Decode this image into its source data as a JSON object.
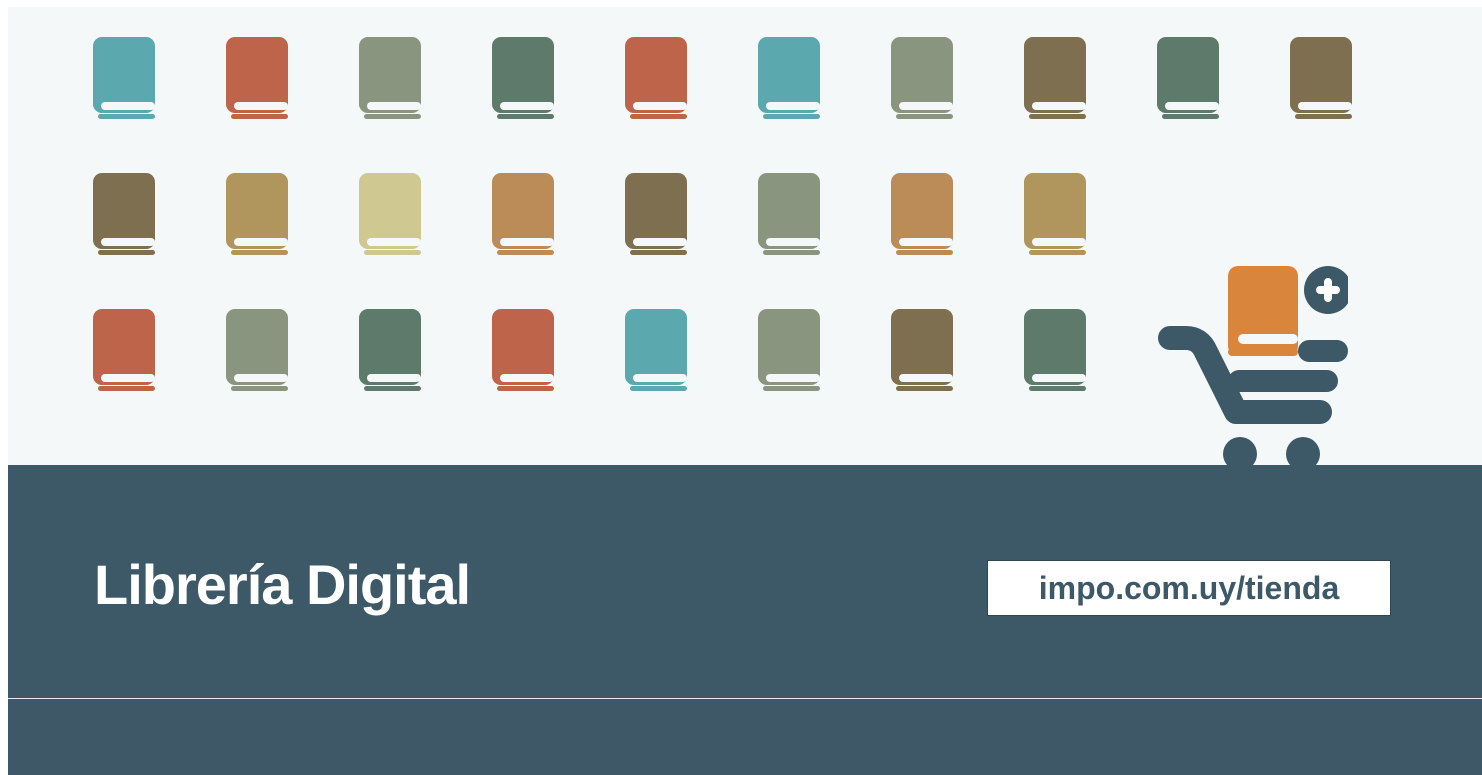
{
  "banner": {
    "title": "Librería Digital",
    "url": "impo.com.uy/tienda"
  },
  "books": {
    "rows": [
      [
        "#5ba8ae",
        "#bd644b",
        "#89957f",
        "#5e7a6b",
        "#bd644b",
        "#5ba8ae",
        "#89957f",
        "#7e6f51",
        "#5e7a6b",
        "#7e6f51"
      ],
      [
        "#7e6f51",
        "#b0955c",
        "#cfc991",
        "#bb8c58",
        "#7e6f51",
        "#89957f",
        "#bb8c58",
        "#b0955c"
      ],
      [
        "#bd644b",
        "#89957f",
        "#5e7a6b",
        "#bd644b",
        "#5ba8ae",
        "#89957f",
        "#7e6f51",
        "#5e7a6b"
      ]
    ]
  },
  "colors": {
    "band": "#3d5866",
    "top_background": "#f5f8f9",
    "cart": "#3d5866",
    "cart_book": "#d9863c",
    "text_on_band": "#ffffff"
  },
  "icons": {
    "cart": "shopping-cart-add-icon",
    "book": "book-icon"
  }
}
